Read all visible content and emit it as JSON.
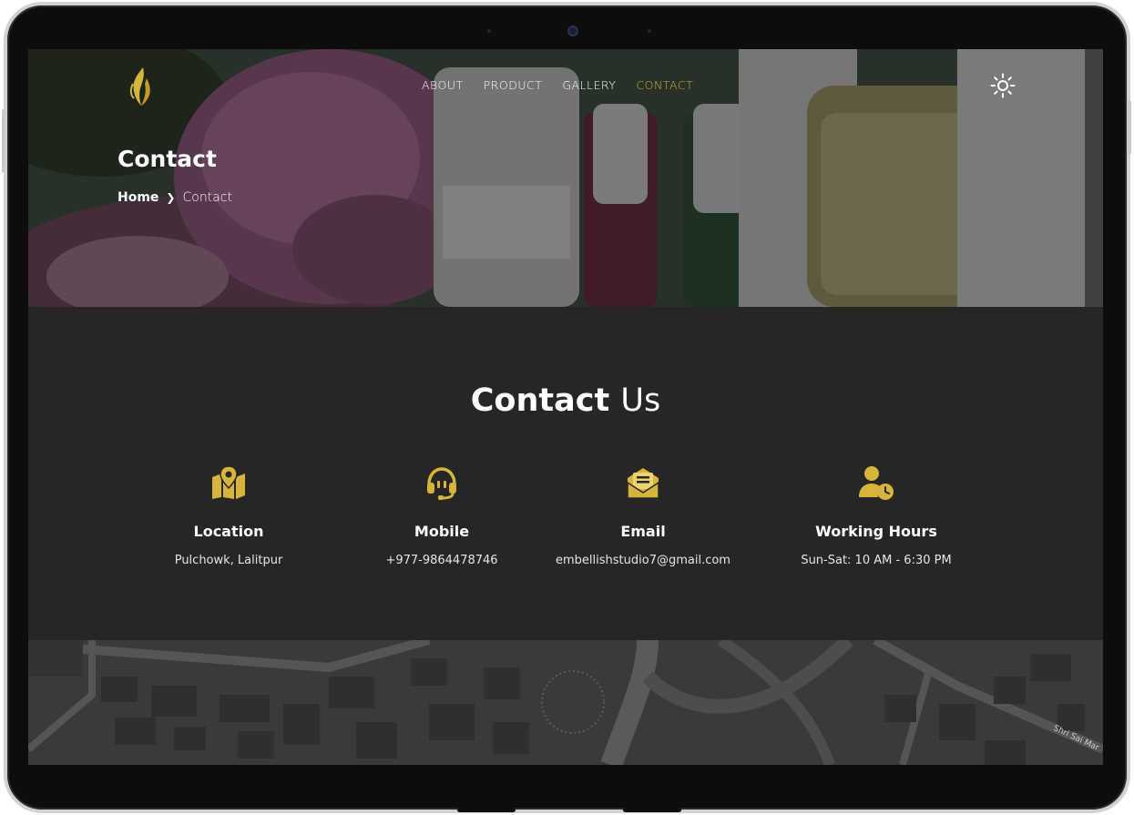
{
  "nav": {
    "items": [
      {
        "label": "ABOUT"
      },
      {
        "label": "PRODUCT"
      },
      {
        "label": "GALLERY"
      },
      {
        "label": "CONTACT",
        "active": true
      }
    ]
  },
  "hero": {
    "title": "Contact",
    "breadcrumb": {
      "home": "Home",
      "current": "Contact"
    }
  },
  "contact": {
    "heading_bold": "Contact",
    "heading_light": "Us",
    "cards": [
      {
        "icon": "map-pin-icon",
        "label": "Location",
        "value": "Pulchowk, Lalitpur"
      },
      {
        "icon": "headset-icon",
        "label": "Mobile",
        "value": "+977-9864478746"
      },
      {
        "icon": "envelope-icon",
        "label": "Email",
        "value": "embellishstudio7@gmail.com"
      },
      {
        "icon": "user-clock-icon",
        "label": "Working Hours",
        "value": "Sun-Sat: 10 AM - 6:30 PM"
      }
    ]
  },
  "map": {
    "street_label": "Shri Sai Mar"
  },
  "colors": {
    "accent": "#d7b43a",
    "section_bg": "#262626",
    "text": "#ffffff"
  }
}
